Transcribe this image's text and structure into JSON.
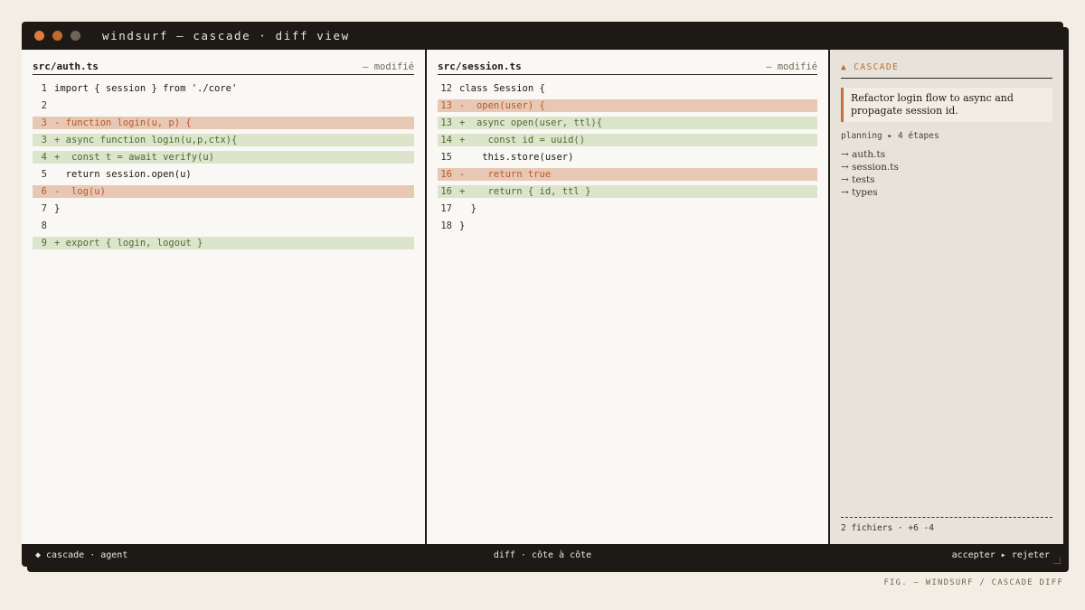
{
  "window": {
    "title": "windsurf — cascade · diff view",
    "traffic_lights": [
      "#e07b3c",
      "#c06a2c",
      "#6e6458"
    ]
  },
  "left_pane": {
    "filename": "src/auth.ts",
    "status": "— modifié",
    "lines": [
      {
        "num": "1",
        "type": "ctx",
        "text": "import { session } from './core'"
      },
      {
        "num": "2",
        "type": "ctx",
        "text": ""
      },
      {
        "num": "3",
        "type": "del",
        "text": "- function login(u, p) {"
      },
      {
        "num": "3",
        "type": "add",
        "text": "+ async function login(u,p,ctx){"
      },
      {
        "num": "4",
        "type": "add",
        "text": "+  const t = await verify(u)"
      },
      {
        "num": "5",
        "type": "ctx",
        "text": "  return session.open(u)"
      },
      {
        "num": "6",
        "type": "del",
        "text": "-  log(u)"
      },
      {
        "num": "7",
        "type": "ctx",
        "text": "}"
      },
      {
        "num": "8",
        "type": "ctx",
        "text": ""
      },
      {
        "num": "9",
        "type": "add",
        "text": "+ export { login, logout }"
      }
    ]
  },
  "right_pane": {
    "filename": "src/session.ts",
    "status": "— modifié",
    "lines": [
      {
        "num": "12",
        "type": "ctx",
        "text": "class Session {"
      },
      {
        "num": "13",
        "type": "del",
        "text": "-  open(user) {"
      },
      {
        "num": "13",
        "type": "add",
        "text": "+  async open(user, ttl){"
      },
      {
        "num": "14",
        "type": "add",
        "text": "+    const id = uuid()"
      },
      {
        "num": "15",
        "type": "ctx",
        "text": "    this.store(user)"
      },
      {
        "num": "16",
        "type": "del",
        "text": "-    return true"
      },
      {
        "num": "16",
        "type": "add",
        "text": "+    return { id, ttl }"
      },
      {
        "num": "17",
        "type": "ctx",
        "text": "  }"
      },
      {
        "num": "18",
        "type": "ctx",
        "text": "}"
      }
    ]
  },
  "cascade": {
    "title": "▲ CASCADE",
    "prompt": "Refactor login flow to async and propagate session id.",
    "planning": "planning ▸ 4 étapes",
    "steps": [
      "→ auth.ts",
      "→ session.ts",
      "→ tests",
      "→ types"
    ],
    "summary": "2 fichiers · +6 -4"
  },
  "statusbar": {
    "left": "◆ cascade · agent",
    "center": "diff · côte à côte",
    "accept": "accepter",
    "separator": "▸",
    "reject": "rejeter"
  },
  "caption": "FIG. — WINDSURF / CASCADE DIFF",
  "colors": {
    "background": "#f4ede4",
    "window": "#1d1915",
    "deletion_bg": "#e8c8b4",
    "deletion_text": "#b75a2b",
    "addition_bg": "#dce5cc",
    "addition_text": "#4f6a33",
    "accent": "#c06a2c"
  }
}
